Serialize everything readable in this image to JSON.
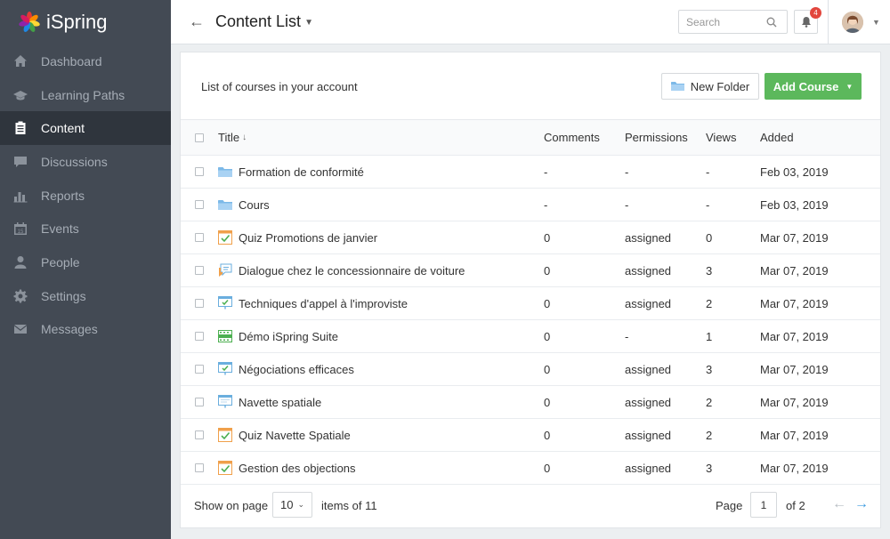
{
  "app": {
    "name": "iSpring"
  },
  "sidebar": {
    "items": [
      {
        "label": "Dashboard",
        "icon": "home-icon",
        "active": false
      },
      {
        "label": "Learning Paths",
        "icon": "graduation-cap-icon",
        "active": false
      },
      {
        "label": "Content",
        "icon": "clipboard-list-icon",
        "active": true
      },
      {
        "label": "Discussions",
        "icon": "comment-icon",
        "active": false
      },
      {
        "label": "Reports",
        "icon": "bar-chart-icon",
        "active": false
      },
      {
        "label": "Events",
        "icon": "calendar-icon",
        "active": false
      },
      {
        "label": "People",
        "icon": "user-icon",
        "active": false
      },
      {
        "label": "Settings",
        "icon": "gear-icon",
        "active": false
      },
      {
        "label": "Messages",
        "icon": "envelope-icon",
        "active": false
      }
    ]
  },
  "header": {
    "title": "Content List",
    "search_placeholder": "Search",
    "notification_count": "4"
  },
  "panel": {
    "description": "List of courses in your account",
    "new_folder_label": "New Folder",
    "add_course_label": "Add Course"
  },
  "table": {
    "columns": {
      "title": "Title",
      "comments": "Comments",
      "permissions": "Permissions",
      "views": "Views",
      "added": "Added"
    },
    "rows": [
      {
        "title": "Formation de conformité",
        "type": "folder",
        "comments": "-",
        "permissions": "-",
        "views": "-",
        "added": "Feb 03, 2019"
      },
      {
        "title": "Cours",
        "type": "folder",
        "comments": "-",
        "permissions": "-",
        "views": "-",
        "added": "Feb 03, 2019"
      },
      {
        "title": "Quiz Promotions de janvier",
        "type": "quiz",
        "comments": "0",
        "permissions": "assigned",
        "views": "0",
        "added": "Mar 07, 2019"
      },
      {
        "title": "Dialogue chez le concessionnaire de voiture",
        "type": "dialogue",
        "comments": "0",
        "permissions": "assigned",
        "views": "3",
        "added": "Mar 07, 2019"
      },
      {
        "title": "Techniques d'appel à l'improviste",
        "type": "presentation-check",
        "comments": "0",
        "permissions": "assigned",
        "views": "2",
        "added": "Mar 07, 2019"
      },
      {
        "title": "Démo iSpring Suite",
        "type": "video",
        "comments": "0",
        "permissions": "-",
        "views": "1",
        "added": "Mar 07, 2019"
      },
      {
        "title": "Négociations efficaces",
        "type": "presentation-check",
        "comments": "0",
        "permissions": "assigned",
        "views": "3",
        "added": "Mar 07, 2019"
      },
      {
        "title": "Navette spatiale",
        "type": "presentation",
        "comments": "0",
        "permissions": "assigned",
        "views": "2",
        "added": "Mar 07, 2019"
      },
      {
        "title": "Quiz Navette Spatiale",
        "type": "quiz",
        "comments": "0",
        "permissions": "assigned",
        "views": "2",
        "added": "Mar 07, 2019"
      },
      {
        "title": "Gestion des objections",
        "type": "quiz",
        "comments": "0",
        "permissions": "assigned",
        "views": "3",
        "added": "Mar 07, 2019"
      }
    ]
  },
  "pagination": {
    "show_on_page_label": "Show on page",
    "per_page": "10",
    "items_of": "items of",
    "total": "11",
    "page_label": "Page",
    "current_page": "1",
    "of_label": "of",
    "total_pages": "2"
  },
  "colors": {
    "sidebar_bg": "#434a54",
    "sidebar_active": "#2f353d",
    "add_button": "#5cb85c",
    "accent_blue": "#3d9be0",
    "badge": "#e2463d"
  }
}
